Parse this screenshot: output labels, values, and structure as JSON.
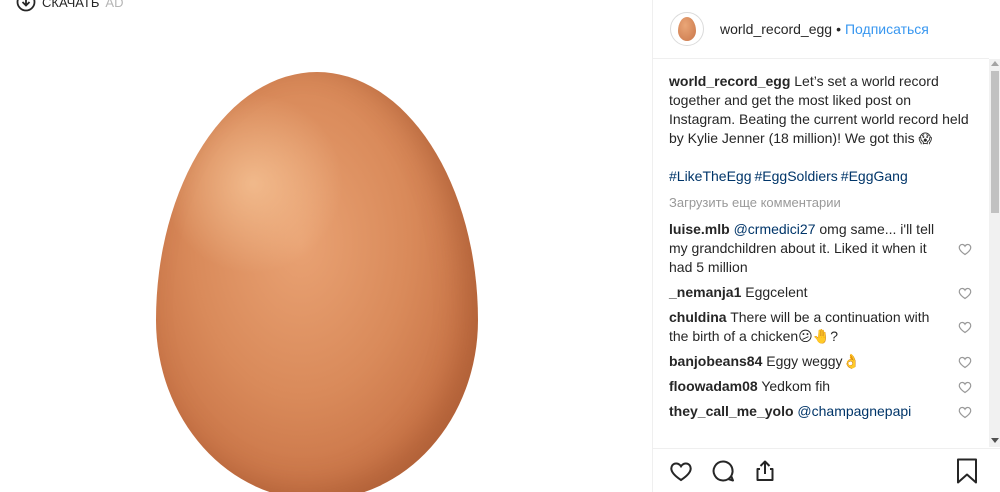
{
  "download": {
    "label": "СКАЧАТЬ",
    "ghost": "AD"
  },
  "header": {
    "username": "world_record_egg",
    "separator": "•",
    "follow_label": "Подписаться"
  },
  "caption": {
    "username": "world_record_egg",
    "text": "Let’s set a world record together and get the most liked post on Instagram. Beating the current world record held by Kylie Jenner (18 million)! We got this",
    "emoji": "😱",
    "hashtags": [
      "#LikeTheEgg",
      "#EggSoldiers",
      "#EggGang"
    ]
  },
  "load_more": "Загрузить еще комментарии",
  "comments": [
    {
      "user": "luise.mlb",
      "mention": "@crmedici27",
      "text": " omg same... i'll tell my grandchildren about it. Liked it when it had 5 million"
    },
    {
      "user": "_nemanja1",
      "mention": "",
      "text": " Eggcelent"
    },
    {
      "user": "chuldina",
      "mention": "",
      "text": " There will be a continuation with the birth of a chicken😕🤚?"
    },
    {
      "user": "banjobeans84",
      "mention": "",
      "text": " Eggy weggy👌"
    },
    {
      "user": "floowadam08",
      "mention": "",
      "text": " Yedkom fih"
    },
    {
      "user": "they_call_me_yolo",
      "mention": "@champagnepapi",
      "text": ""
    }
  ],
  "icons": {
    "download": "download-icon",
    "like": "heart-icon",
    "comment": "comment-icon",
    "share": "share-icon",
    "save": "bookmark-icon",
    "comment_like": "small-heart-icon"
  },
  "colors": {
    "link": "#3897f0",
    "hashtag": "#003569",
    "muted": "#999999",
    "text": "#262626",
    "egg": "#d98a5a"
  }
}
